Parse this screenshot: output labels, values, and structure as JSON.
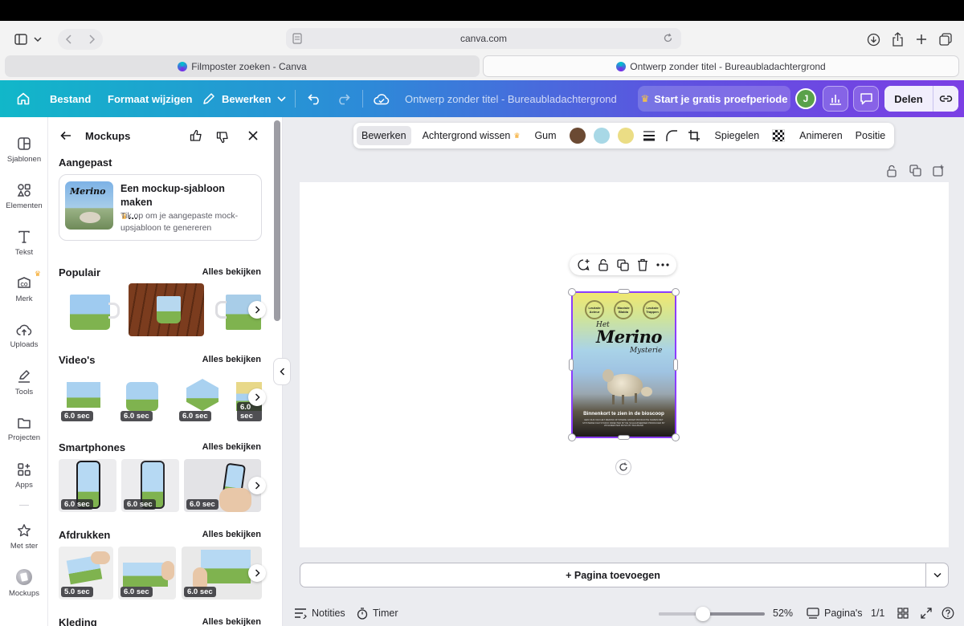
{
  "browser": {
    "url": "canva.com",
    "tabs": [
      {
        "label": "Filmposter zoeken - Canva",
        "active": false
      },
      {
        "label": "Ontwerp zonder titel - Bureaubladachtergrond",
        "active": true
      }
    ]
  },
  "header": {
    "file": "Bestand",
    "resize": "Formaat wijzigen",
    "edit": "Bewerken",
    "title": "Ontwerp zonder titel - Bureaubladachtergrond",
    "trial": "Start je gratis proefperiode",
    "avatar_initial": "J",
    "share": "Delen",
    "accent_colors": {
      "start": "#11b7c9",
      "end": "#7b3fe4"
    }
  },
  "rail": [
    {
      "label": "Sjablonen",
      "icon": "template-icon"
    },
    {
      "label": "Elementen",
      "icon": "shapes-icon"
    },
    {
      "label": "Tekst",
      "icon": "text-icon"
    },
    {
      "label": "Merk",
      "icon": "brand-icon"
    },
    {
      "label": "Uploads",
      "icon": "upload-icon"
    },
    {
      "label": "Tools",
      "icon": "pen-icon"
    },
    {
      "label": "Projecten",
      "icon": "folder-icon"
    },
    {
      "label": "Apps",
      "icon": "apps-icon"
    },
    {
      "label": "Met ster",
      "icon": "star-icon"
    },
    {
      "label": "Mockups",
      "icon": "mockups-icon"
    }
  ],
  "panel": {
    "title": "Mockups",
    "custom_section": "Aangepast",
    "custom_card": {
      "title": "Een mockup-sjabloon maken",
      "title_suffix": "…",
      "description": "Tik op om je aangepaste mock-upsjabloon te genereren"
    },
    "see_all": "Alles bekijken",
    "sections": [
      {
        "title": "Populair",
        "durations": [
          "",
          "",
          ""
        ]
      },
      {
        "title": "Video's",
        "durations": [
          "6.0 sec",
          "6.0 sec",
          "6.0 sec",
          "6.0 sec"
        ]
      },
      {
        "title": "Smartphones",
        "durations": [
          "6.0 sec",
          "6.0 sec",
          "6.0 sec"
        ]
      },
      {
        "title": "Afdrukken",
        "durations": [
          "5.0 sec",
          "6.0 sec",
          "6.0 sec"
        ]
      },
      {
        "title": "Kleding",
        "durations": []
      }
    ]
  },
  "context_toolbar": {
    "edit": "Bewerken",
    "remove_bg": "Achtergrond wissen",
    "eraser": "Gum",
    "swatches": [
      "#6b4a33",
      "#a8d8e6",
      "#ebdd85"
    ],
    "flip": "Spiegelen",
    "animate": "Animeren",
    "position": "Positie"
  },
  "poster": {
    "badges": [
      "Leukste Acteur",
      "Mooiste Blabla",
      "Leukste Trappen"
    ],
    "title_small": "Het",
    "title_main": "Merino",
    "title_sub": "Mysterie",
    "tagline": "Binnenkort te zien in de bioscoop",
    "credits": "EEN FILM VAN HET MERINO MYSTERIE GROEP PRODUCTIE SAMEN MET MYSTERIE FILM STUDIO DIRECTED BY DE SCHAAPHERDER PRODUCED BY WOLMEESTER MUSIC BY BAA BAND"
  },
  "workspace": {
    "add_page": "+ Pagina toevoegen"
  },
  "bottom": {
    "notes": "Notities",
    "timer": "Timer",
    "zoom_value": 0.42,
    "zoom": "52%",
    "pages": "Pagina's",
    "page_count": "1/1"
  }
}
